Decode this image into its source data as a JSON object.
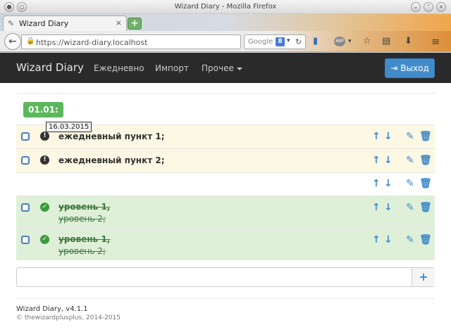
{
  "window": {
    "title": "Wizard Diary - Mozilla Firefox"
  },
  "tab": {
    "label": "Wizard Diary",
    "close": "×",
    "new": "+"
  },
  "toolbar": {
    "url": "https://wizard-diary.localhost",
    "search_placeholder": "Google",
    "search_badge": "8",
    "abp": "ABP"
  },
  "nav": {
    "brand": "Wizard Diary",
    "links": [
      "Ежедневно",
      "Импорт",
      "Прочее"
    ],
    "logout": "Выход"
  },
  "date_label": "01.01:",
  "tooltip": "16.03.2015",
  "items": [
    {
      "text": "ежедневный пункт 1;",
      "status": "important"
    },
    {
      "text": "ежедневный пункт 2;",
      "status": "important"
    },
    {
      "text": "",
      "status": "empty"
    },
    {
      "lines": [
        "уровень 1,",
        "уровень 2;"
      ],
      "status": "done"
    },
    {
      "lines": [
        "уровень 1,",
        "уровень 2;"
      ],
      "status": "done"
    }
  ],
  "add": {
    "value": "",
    "button": "+"
  },
  "footer": {
    "version": "Wizard Diary, v4.1.1",
    "copyright": "© thewizardplusplus, 2014-2015"
  },
  "colors": {
    "navbar": "#2a2a2a",
    "primary": "#428bca",
    "success": "#5cb85c",
    "warning_bg": "#fcf8e3",
    "done_bg": "#dff0d8"
  }
}
